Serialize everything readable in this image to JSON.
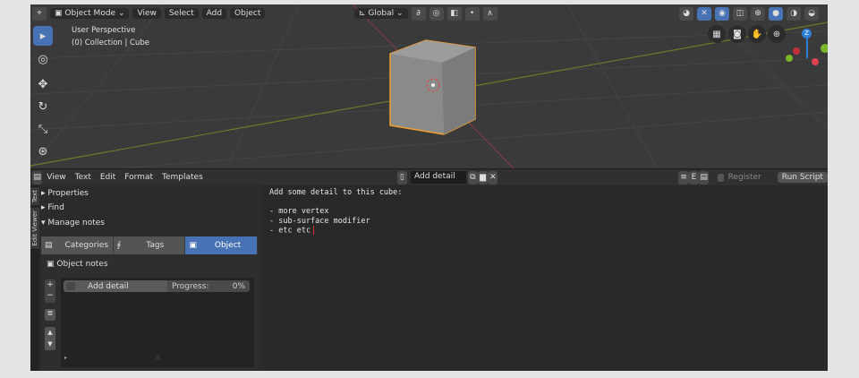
{
  "viewport": {
    "mode": "Object Mode",
    "menus": [
      "View",
      "Select",
      "Add",
      "Object"
    ],
    "overlay_title": "User Perspective",
    "overlay_collection": "(0) Collection | Cube",
    "orientation": "Global",
    "gizmo": {
      "z": "Z"
    }
  },
  "text_editor": {
    "menus": [
      "View",
      "Text",
      "Edit",
      "Format",
      "Templates"
    ],
    "text_name": "Add detail",
    "register_label": "Register",
    "run_script_label": "Run Script",
    "lines": [
      "Add some detail to this cube:",
      "",
      "- more vertex",
      "- sub-surface modifier",
      "- etc etc"
    ]
  },
  "sidebar": {
    "vertical_tabs": [
      "Text",
      "Edit Viewer"
    ],
    "panels": [
      "Properties",
      "Find",
      "Manage notes"
    ],
    "tabs": [
      "Categories",
      "Tags",
      "Object"
    ],
    "object_notes_label": "Object notes",
    "note": {
      "name": "Add detail",
      "progress_label": "Progress:",
      "progress_value": "0%"
    }
  },
  "colors": {
    "accent": "#4772b3",
    "selection": "#f0a030"
  }
}
